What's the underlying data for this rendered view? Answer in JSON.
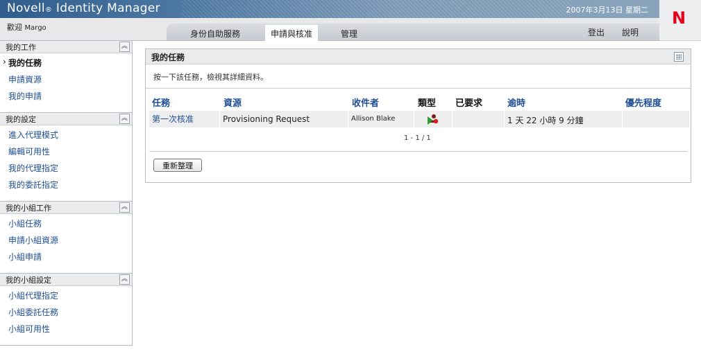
{
  "banner": {
    "brand": "Novell",
    "brand_reg": "®",
    "product": "Identity Manager",
    "date": "2007年3月13日 星期二"
  },
  "logo": {
    "letter": "N"
  },
  "user": {
    "welcome": "歡迎",
    "name": "Margo"
  },
  "tabs": [
    {
      "label": "身份自助服務"
    },
    {
      "label": "申請與核准"
    },
    {
      "label": "管理"
    }
  ],
  "toplinks": {
    "logout": "登出",
    "help": "說明"
  },
  "sidebar": {
    "sections": [
      {
        "title": "我的工作",
        "items": [
          "我的任務",
          "申請資源",
          "我的申請"
        ]
      },
      {
        "title": "我的設定",
        "items": [
          "進入代理模式",
          "編輯可用性",
          "我的代理指定",
          "我的委託指定"
        ]
      },
      {
        "title": "我的小組工作",
        "items": [
          "小組任務",
          "申請小組資源",
          "小組申請"
        ]
      },
      {
        "title": "我的小組設定",
        "items": [
          "小組代理指定",
          "小組委託任務",
          "小組可用性"
        ]
      }
    ],
    "collapse_glyph": "︽"
  },
  "panel": {
    "title": "我的任務",
    "instruction": "按一下該任務，檢視其詳細資料。",
    "columns": [
      "任務",
      "資源",
      "收件者",
      "類型",
      "已要求",
      "逾時",
      "優先程度"
    ],
    "rows": [
      {
        "task": "第一次核准",
        "resource": "Provisioning Request",
        "recipient": "Allison Blake",
        "type_icon": "provisioning-request-icon",
        "requested": "",
        "overdue": "1 天 22 小時 9 分鐘",
        "priority": ""
      }
    ],
    "pager": "1 - 1 / 1",
    "refresh_label": "重新整理"
  }
}
